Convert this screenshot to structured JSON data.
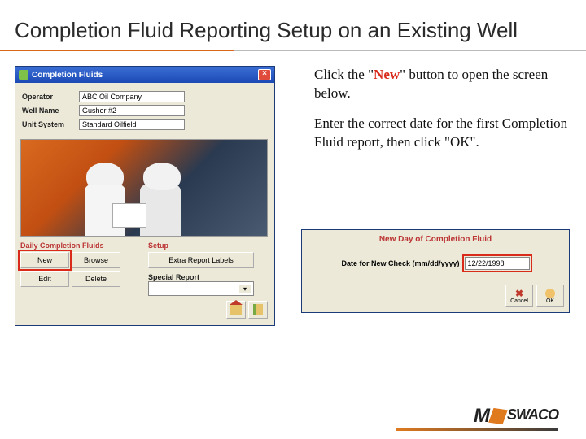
{
  "slide": {
    "title": "Completion Fluid Reporting Setup on an Existing Well"
  },
  "instructions": {
    "line1_pre": "Click the \"",
    "line1_hl": "New",
    "line1_post": "\" button to open the screen below.",
    "line2": "Enter the correct date for the first Completion Fluid report, then click \"OK\"."
  },
  "window1": {
    "title": "Completion Fluids",
    "fields": {
      "operator_label": "Operator",
      "operator_value": "ABC Oil Company",
      "wellname_label": "Well Name",
      "wellname_value": "Gusher #2",
      "unitsystem_label": "Unit System",
      "unitsystem_value": "Standard Oilfield"
    },
    "sections": {
      "daily_label": "Daily Completion Fluids",
      "setup_label": "Setup"
    },
    "buttons": {
      "new": "New",
      "browse": "Browse",
      "edit": "Edit",
      "delete": "Delete",
      "extra_report_labels": "Extra Report Labels"
    },
    "special_report_label": "Special Report",
    "special_report_value": ""
  },
  "window2": {
    "title": "New Day of Completion Fluid",
    "date_label": "Date for New Check (mm/dd/yyyy)",
    "date_value": "12/22/1998",
    "cancel_label": "Cancel",
    "ok_label": "OK"
  },
  "branding": {
    "logo_part1": "M",
    "logo_part2": "SWACO"
  }
}
